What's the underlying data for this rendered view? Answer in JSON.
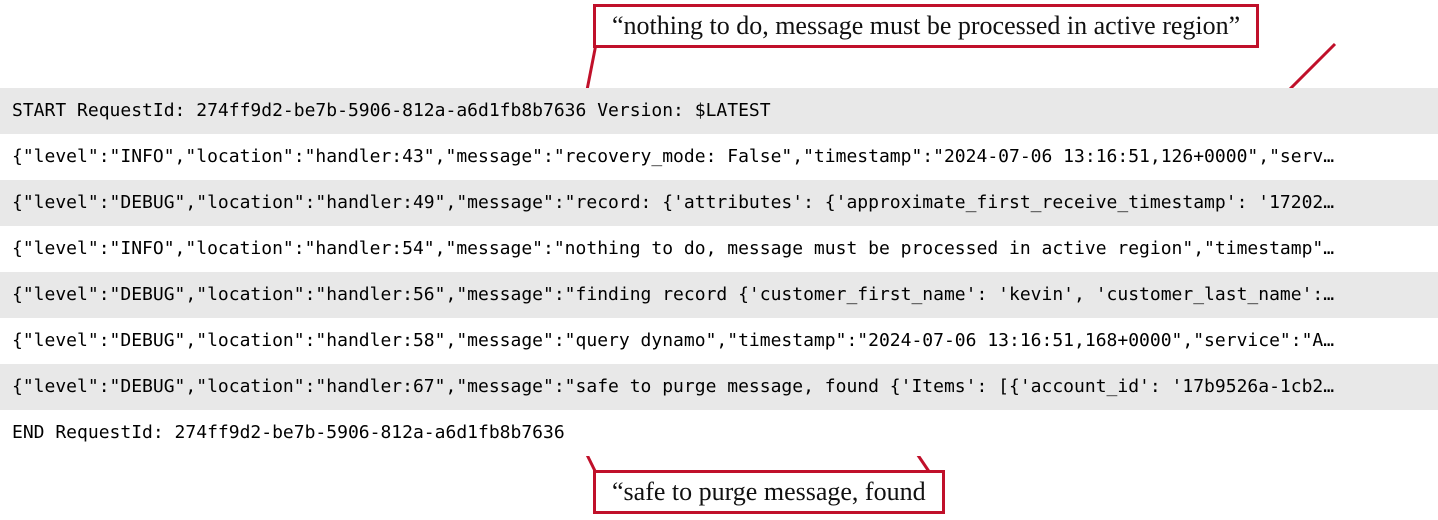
{
  "callouts": {
    "top": "“nothing to do, message must be processed in active region”",
    "bottom": "“safe to purge message, found"
  },
  "logs": {
    "rows": [
      "START RequestId: 274ff9d2-be7b-5906-812a-a6d1fb8b7636 Version: $LATEST",
      "{\"level\":\"INFO\",\"location\":\"handler:43\",\"message\":\"recovery_mode: False\",\"timestamp\":\"2024-07-06 13:16:51,126+0000\",\"serv…",
      "{\"level\":\"DEBUG\",\"location\":\"handler:49\",\"message\":\"record: {'attributes': {'approximate_first_receive_timestamp': '17202…",
      "{\"level\":\"INFO\",\"location\":\"handler:54\",\"message\":\"nothing to do, message must be processed in active region\",\"timestamp\"…",
      "{\"level\":\"DEBUG\",\"location\":\"handler:56\",\"message\":\"finding record {'customer_first_name': 'kevin', 'customer_last_name':…",
      "{\"level\":\"DEBUG\",\"location\":\"handler:58\",\"message\":\"query dynamo\",\"timestamp\":\"2024-07-06 13:16:51,168+0000\",\"service\":\"A…",
      "{\"level\":\"DEBUG\",\"location\":\"handler:67\",\"message\":\"safe to purge message, found {'Items': [{'account_id': '17b9526a-1cb2…",
      "END RequestId: 274ff9d2-be7b-5906-812a-a6d1fb8b7636"
    ]
  }
}
